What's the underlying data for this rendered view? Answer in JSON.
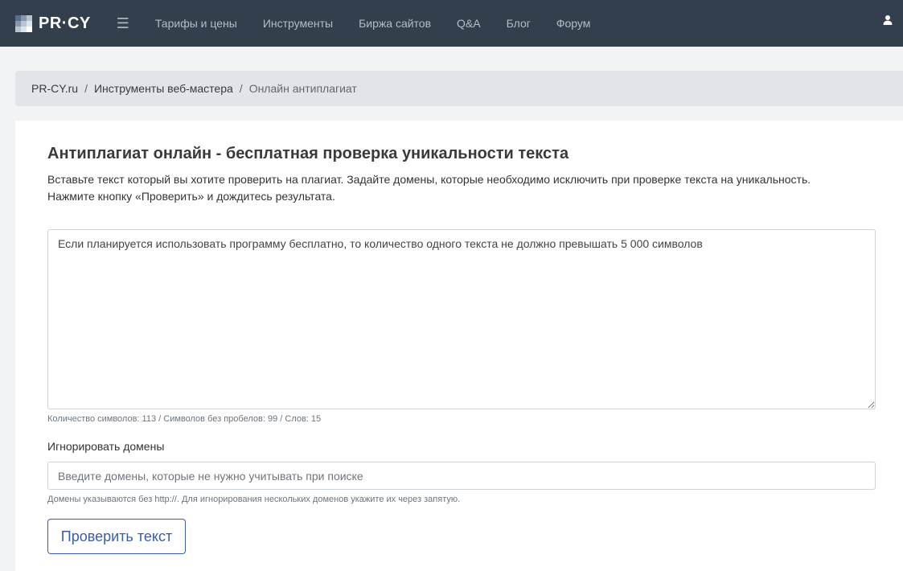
{
  "header": {
    "logo_text": "PR·CY",
    "logo_colors": [
      "#5a6f8f",
      "#8596b0",
      "#bac4d3",
      "#8596b0",
      "#bac4d3",
      "#dfe4ec",
      "#bac4d3",
      "#dfe4ec",
      "#ffffff"
    ],
    "menu_icon": "hamburger-menu-icon",
    "nav": [
      {
        "label": "Тарифы и цены"
      },
      {
        "label": "Инструменты"
      },
      {
        "label": "Биржа сайтов"
      },
      {
        "label": "Q&A"
      },
      {
        "label": "Блог"
      },
      {
        "label": "Форум"
      }
    ],
    "user_icon": "user-icon",
    "background": "#343f4e"
  },
  "breadcrumb": {
    "items": [
      "PR-CY.ru",
      "Инструменты веб-мастера",
      "Онлайн антиплагиат"
    ],
    "separator": "/"
  },
  "main": {
    "title": "Антиплагиат онлайн - бесплатная проверка уникальности текста",
    "intro_line1": "Вставьте текст который вы хотите проверить на плагиат. Задайте домены, которые необходимо исключить при проверке текста на уникальность.",
    "intro_line2": "Нажмите кнопку «Проверить» и дождитесь результата.",
    "text_value": "Если планируется использовать программу бесплатно, то количество одного текста не должно превышать 5 000 символов",
    "counter": "Количество символов: 113 / Символов без пробелов: 99 / Слов: 15",
    "ignore_label": "Игнорировать домены",
    "domains_placeholder": "Введите домены, которые не нужно учитывать при поиске",
    "domains_value": "",
    "hint": "Домены указываются без http://. Для игнорирования нескольких доменов укажите их через запятую.",
    "check_button": "Проверить текст",
    "accent_color": "#3b5ea8"
  }
}
